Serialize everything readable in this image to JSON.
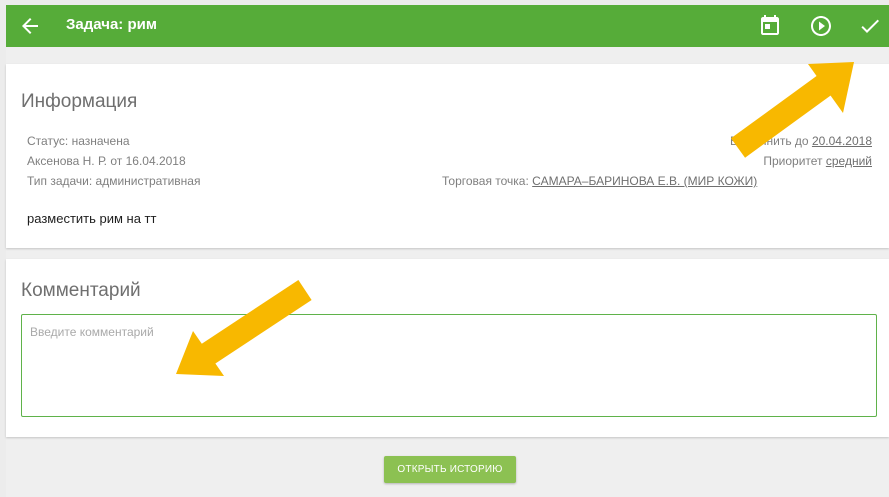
{
  "appbar": {
    "title": "Задача: рим",
    "back_icon": "arrow-left-icon",
    "actions": [
      "calendar-icon",
      "play-circle-icon",
      "check-icon"
    ],
    "color": "#56ac39"
  },
  "info": {
    "section_title": "Информация",
    "status": "Статус: назначена",
    "author": "Аксенова Н. Р. от 16.04.2018",
    "task_type": "Тип задачи: административная",
    "due_label": "Выполнить до",
    "due_date": "20.04.2018",
    "priority_label": "Приоритет",
    "priority_value": "средний",
    "outlet_label": "Торговая точка:",
    "outlet_value": "САМАРА–БАРИНОВА Е.В. (МИР КОЖИ)",
    "task_text": "разместить рим на тт"
  },
  "comment": {
    "section_title": "Комментарий",
    "placeholder": "Введите комментарий",
    "value": ""
  },
  "history_button": "ОТКРЫТЬ ИСТОРИЮ",
  "annotations": {
    "arrow_color": "#f8b800"
  }
}
